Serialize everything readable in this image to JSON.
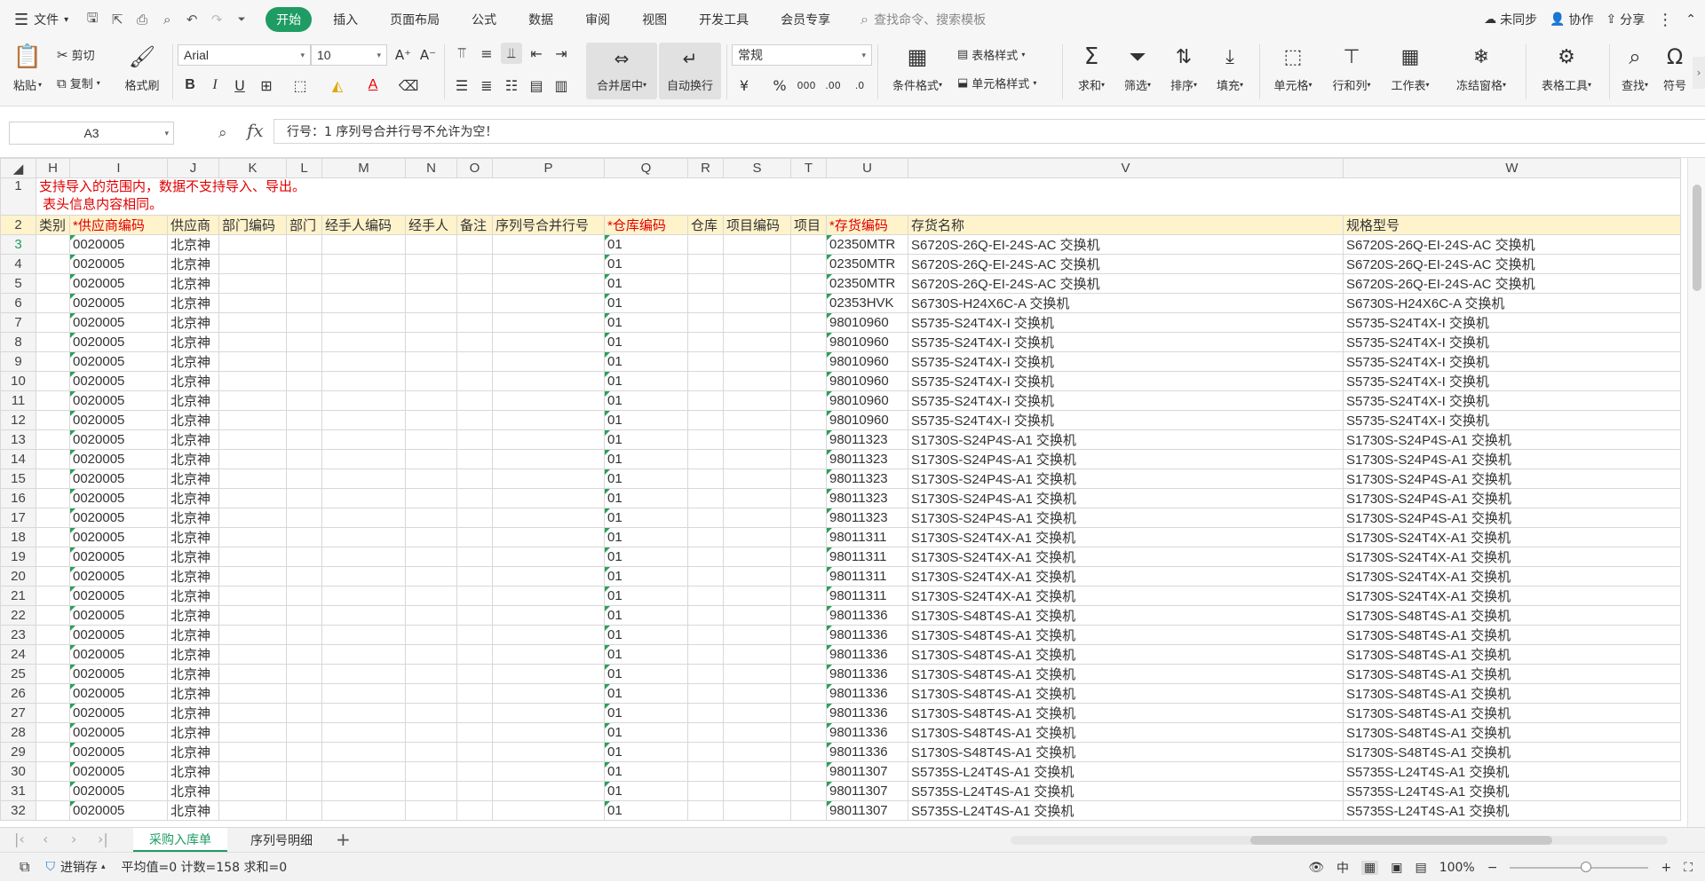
{
  "menu": {
    "file_label": "文件",
    "tabs": [
      "开始",
      "插入",
      "页面布局",
      "公式",
      "数据",
      "审阅",
      "视图",
      "开发工具",
      "会员专享"
    ],
    "search_placeholder": "查找命令、搜索模板",
    "unsynced": "未同步",
    "collab": "协作",
    "share": "分享"
  },
  "ribbon": {
    "paste": "粘贴",
    "cut": "剪切",
    "copy": "复制",
    "format_painter": "格式刷",
    "font_name": "Arial",
    "font_size": "10",
    "merge_center": "合并居中",
    "wrap_text": "自动换行",
    "number_format": "常规",
    "conditional_format": "条件格式",
    "table_style": "表格样式",
    "cell_style": "单元格样式",
    "sum": "求和",
    "filter": "筛选",
    "sort": "排序",
    "fill": "填充",
    "cell": "单元格",
    "row_col": "行和列",
    "worksheet": "工作表",
    "freeze": "冻结窗格",
    "table_tools": "表格工具",
    "find": "查找",
    "symbol": "符号"
  },
  "formula_bar": {
    "name_box": "A3",
    "fx": "fx",
    "content": "行号：1 序列号合并行号不允许为空！"
  },
  "columns": [
    "H",
    "I",
    "J",
    "K",
    "L",
    "M",
    "N",
    "O",
    "P",
    "Q",
    "R",
    "S",
    "T",
    "U",
    "V",
    "W"
  ],
  "notice": "支持导入的范围内，数据不支持导入、导出。\n 表头信息内容相同。",
  "headers": [
    "类别",
    "*供应商编码",
    "供应商",
    "部门编码",
    "部门",
    "经手人编码",
    "经手人",
    "备注",
    "序列号合并行号",
    "*仓库编码",
    "仓库",
    "项目编码",
    "项目",
    "*存货编码",
    "存货名称",
    "规格型号"
  ],
  "rows": [
    {
      "n": "3",
      "sup": "0020005",
      "supname": "北京神",
      "wh": "01",
      "code": "02350MTR",
      "name": "S6720S-26Q-EI-24S-AC  交换机",
      "spec": "S6720S-26Q-EI-24S-AC  交换机"
    },
    {
      "n": "4",
      "sup": "0020005",
      "supname": "北京神",
      "wh": "01",
      "code": "02350MTR",
      "name": "S6720S-26Q-EI-24S-AC  交换机",
      "spec": "S6720S-26Q-EI-24S-AC  交换机"
    },
    {
      "n": "5",
      "sup": "0020005",
      "supname": "北京神",
      "wh": "01",
      "code": "02350MTR",
      "name": "S6720S-26Q-EI-24S-AC  交换机",
      "spec": "S6720S-26Q-EI-24S-AC  交换机"
    },
    {
      "n": "6",
      "sup": "0020005",
      "supname": "北京神",
      "wh": "01",
      "code": "02353HVK",
      "name": "S6730S-H24X6C-A 交换机",
      "spec": "S6730S-H24X6C-A 交换机"
    },
    {
      "n": "7",
      "sup": "0020005",
      "supname": "北京神",
      "wh": "01",
      "code": "98010960",
      "name": "S5735-S24T4X-I 交换机",
      "spec": "S5735-S24T4X-I 交换机"
    },
    {
      "n": "8",
      "sup": "0020005",
      "supname": "北京神",
      "wh": "01",
      "code": "98010960",
      "name": "S5735-S24T4X-I 交换机",
      "spec": "S5735-S24T4X-I 交换机"
    },
    {
      "n": "9",
      "sup": "0020005",
      "supname": "北京神",
      "wh": "01",
      "code": "98010960",
      "name": "S5735-S24T4X-I 交换机",
      "spec": "S5735-S24T4X-I 交换机"
    },
    {
      "n": "10",
      "sup": "0020005",
      "supname": "北京神",
      "wh": "01",
      "code": "98010960",
      "name": "S5735-S24T4X-I 交换机",
      "spec": "S5735-S24T4X-I 交换机"
    },
    {
      "n": "11",
      "sup": "0020005",
      "supname": "北京神",
      "wh": "01",
      "code": "98010960",
      "name": "S5735-S24T4X-I 交换机",
      "spec": "S5735-S24T4X-I 交换机"
    },
    {
      "n": "12",
      "sup": "0020005",
      "supname": "北京神",
      "wh": "01",
      "code": "98010960",
      "name": "S5735-S24T4X-I 交换机",
      "spec": "S5735-S24T4X-I 交换机"
    },
    {
      "n": "13",
      "sup": "0020005",
      "supname": "北京神",
      "wh": "01",
      "code": "98011323",
      "name": "S1730S-S24P4S-A1 交换机",
      "spec": "S1730S-S24P4S-A1 交换机"
    },
    {
      "n": "14",
      "sup": "0020005",
      "supname": "北京神",
      "wh": "01",
      "code": "98011323",
      "name": "S1730S-S24P4S-A1 交换机",
      "spec": "S1730S-S24P4S-A1 交换机"
    },
    {
      "n": "15",
      "sup": "0020005",
      "supname": "北京神",
      "wh": "01",
      "code": "98011323",
      "name": "S1730S-S24P4S-A1 交换机",
      "spec": "S1730S-S24P4S-A1 交换机"
    },
    {
      "n": "16",
      "sup": "0020005",
      "supname": "北京神",
      "wh": "01",
      "code": "98011323",
      "name": "S1730S-S24P4S-A1 交换机",
      "spec": "S1730S-S24P4S-A1 交换机"
    },
    {
      "n": "17",
      "sup": "0020005",
      "supname": "北京神",
      "wh": "01",
      "code": "98011323",
      "name": "S1730S-S24P4S-A1 交换机",
      "spec": "S1730S-S24P4S-A1 交换机"
    },
    {
      "n": "18",
      "sup": "0020005",
      "supname": "北京神",
      "wh": "01",
      "code": "98011311",
      "name": "S1730S-S24T4X-A1 交换机",
      "spec": "S1730S-S24T4X-A1 交换机"
    },
    {
      "n": "19",
      "sup": "0020005",
      "supname": "北京神",
      "wh": "01",
      "code": "98011311",
      "name": "S1730S-S24T4X-A1 交换机",
      "spec": "S1730S-S24T4X-A1 交换机"
    },
    {
      "n": "20",
      "sup": "0020005",
      "supname": "北京神",
      "wh": "01",
      "code": "98011311",
      "name": "S1730S-S24T4X-A1 交换机",
      "spec": "S1730S-S24T4X-A1 交换机"
    },
    {
      "n": "21",
      "sup": "0020005",
      "supname": "北京神",
      "wh": "01",
      "code": "98011311",
      "name": "S1730S-S24T4X-A1 交换机",
      "spec": "S1730S-S24T4X-A1 交换机"
    },
    {
      "n": "22",
      "sup": "0020005",
      "supname": "北京神",
      "wh": "01",
      "code": "98011336",
      "name": "S1730S-S48T4S-A1 交换机",
      "spec": "S1730S-S48T4S-A1 交换机"
    },
    {
      "n": "23",
      "sup": "0020005",
      "supname": "北京神",
      "wh": "01",
      "code": "98011336",
      "name": "S1730S-S48T4S-A1 交换机",
      "spec": "S1730S-S48T4S-A1 交换机"
    },
    {
      "n": "24",
      "sup": "0020005",
      "supname": "北京神",
      "wh": "01",
      "code": "98011336",
      "name": "S1730S-S48T4S-A1 交换机",
      "spec": "S1730S-S48T4S-A1 交换机"
    },
    {
      "n": "25",
      "sup": "0020005",
      "supname": "北京神",
      "wh": "01",
      "code": "98011336",
      "name": "S1730S-S48T4S-A1 交换机",
      "spec": "S1730S-S48T4S-A1 交换机"
    },
    {
      "n": "26",
      "sup": "0020005",
      "supname": "北京神",
      "wh": "01",
      "code": "98011336",
      "name": "S1730S-S48T4S-A1 交换机",
      "spec": "S1730S-S48T4S-A1 交换机"
    },
    {
      "n": "27",
      "sup": "0020005",
      "supname": "北京神",
      "wh": "01",
      "code": "98011336",
      "name": "S1730S-S48T4S-A1 交换机",
      "spec": "S1730S-S48T4S-A1 交换机"
    },
    {
      "n": "28",
      "sup": "0020005",
      "supname": "北京神",
      "wh": "01",
      "code": "98011336",
      "name": "S1730S-S48T4S-A1 交换机",
      "spec": "S1730S-S48T4S-A1 交换机"
    },
    {
      "n": "29",
      "sup": "0020005",
      "supname": "北京神",
      "wh": "01",
      "code": "98011336",
      "name": "S1730S-S48T4S-A1 交换机",
      "spec": "S1730S-S48T4S-A1 交换机"
    },
    {
      "n": "30",
      "sup": "0020005",
      "supname": "北京神",
      "wh": "01",
      "code": "98011307",
      "name": "S5735S-L24T4S-A1 交换机",
      "spec": "S5735S-L24T4S-A1 交换机"
    },
    {
      "n": "31",
      "sup": "0020005",
      "supname": "北京神",
      "wh": "01",
      "code": "98011307",
      "name": "S5735S-L24T4S-A1 交换机",
      "spec": "S5735S-L24T4S-A1 交换机"
    },
    {
      "n": "32",
      "sup": "0020005",
      "supname": "北京神",
      "wh": "01",
      "code": "98011307",
      "name": "S5735S-L24T4S-A1 交换机",
      "spec": "S5735S-L24T4S-A1 交换机"
    }
  ],
  "sheet_tabs": [
    "采购入库单",
    "序列号明细"
  ],
  "status": {
    "macro": "进销存",
    "stats": "平均值=0  计数=158  求和=0",
    "lang": "中",
    "zoom": "100%"
  },
  "colors": {
    "accent": "#1e9c63",
    "required": "#e00000",
    "header_fill": "#fff3cc"
  }
}
